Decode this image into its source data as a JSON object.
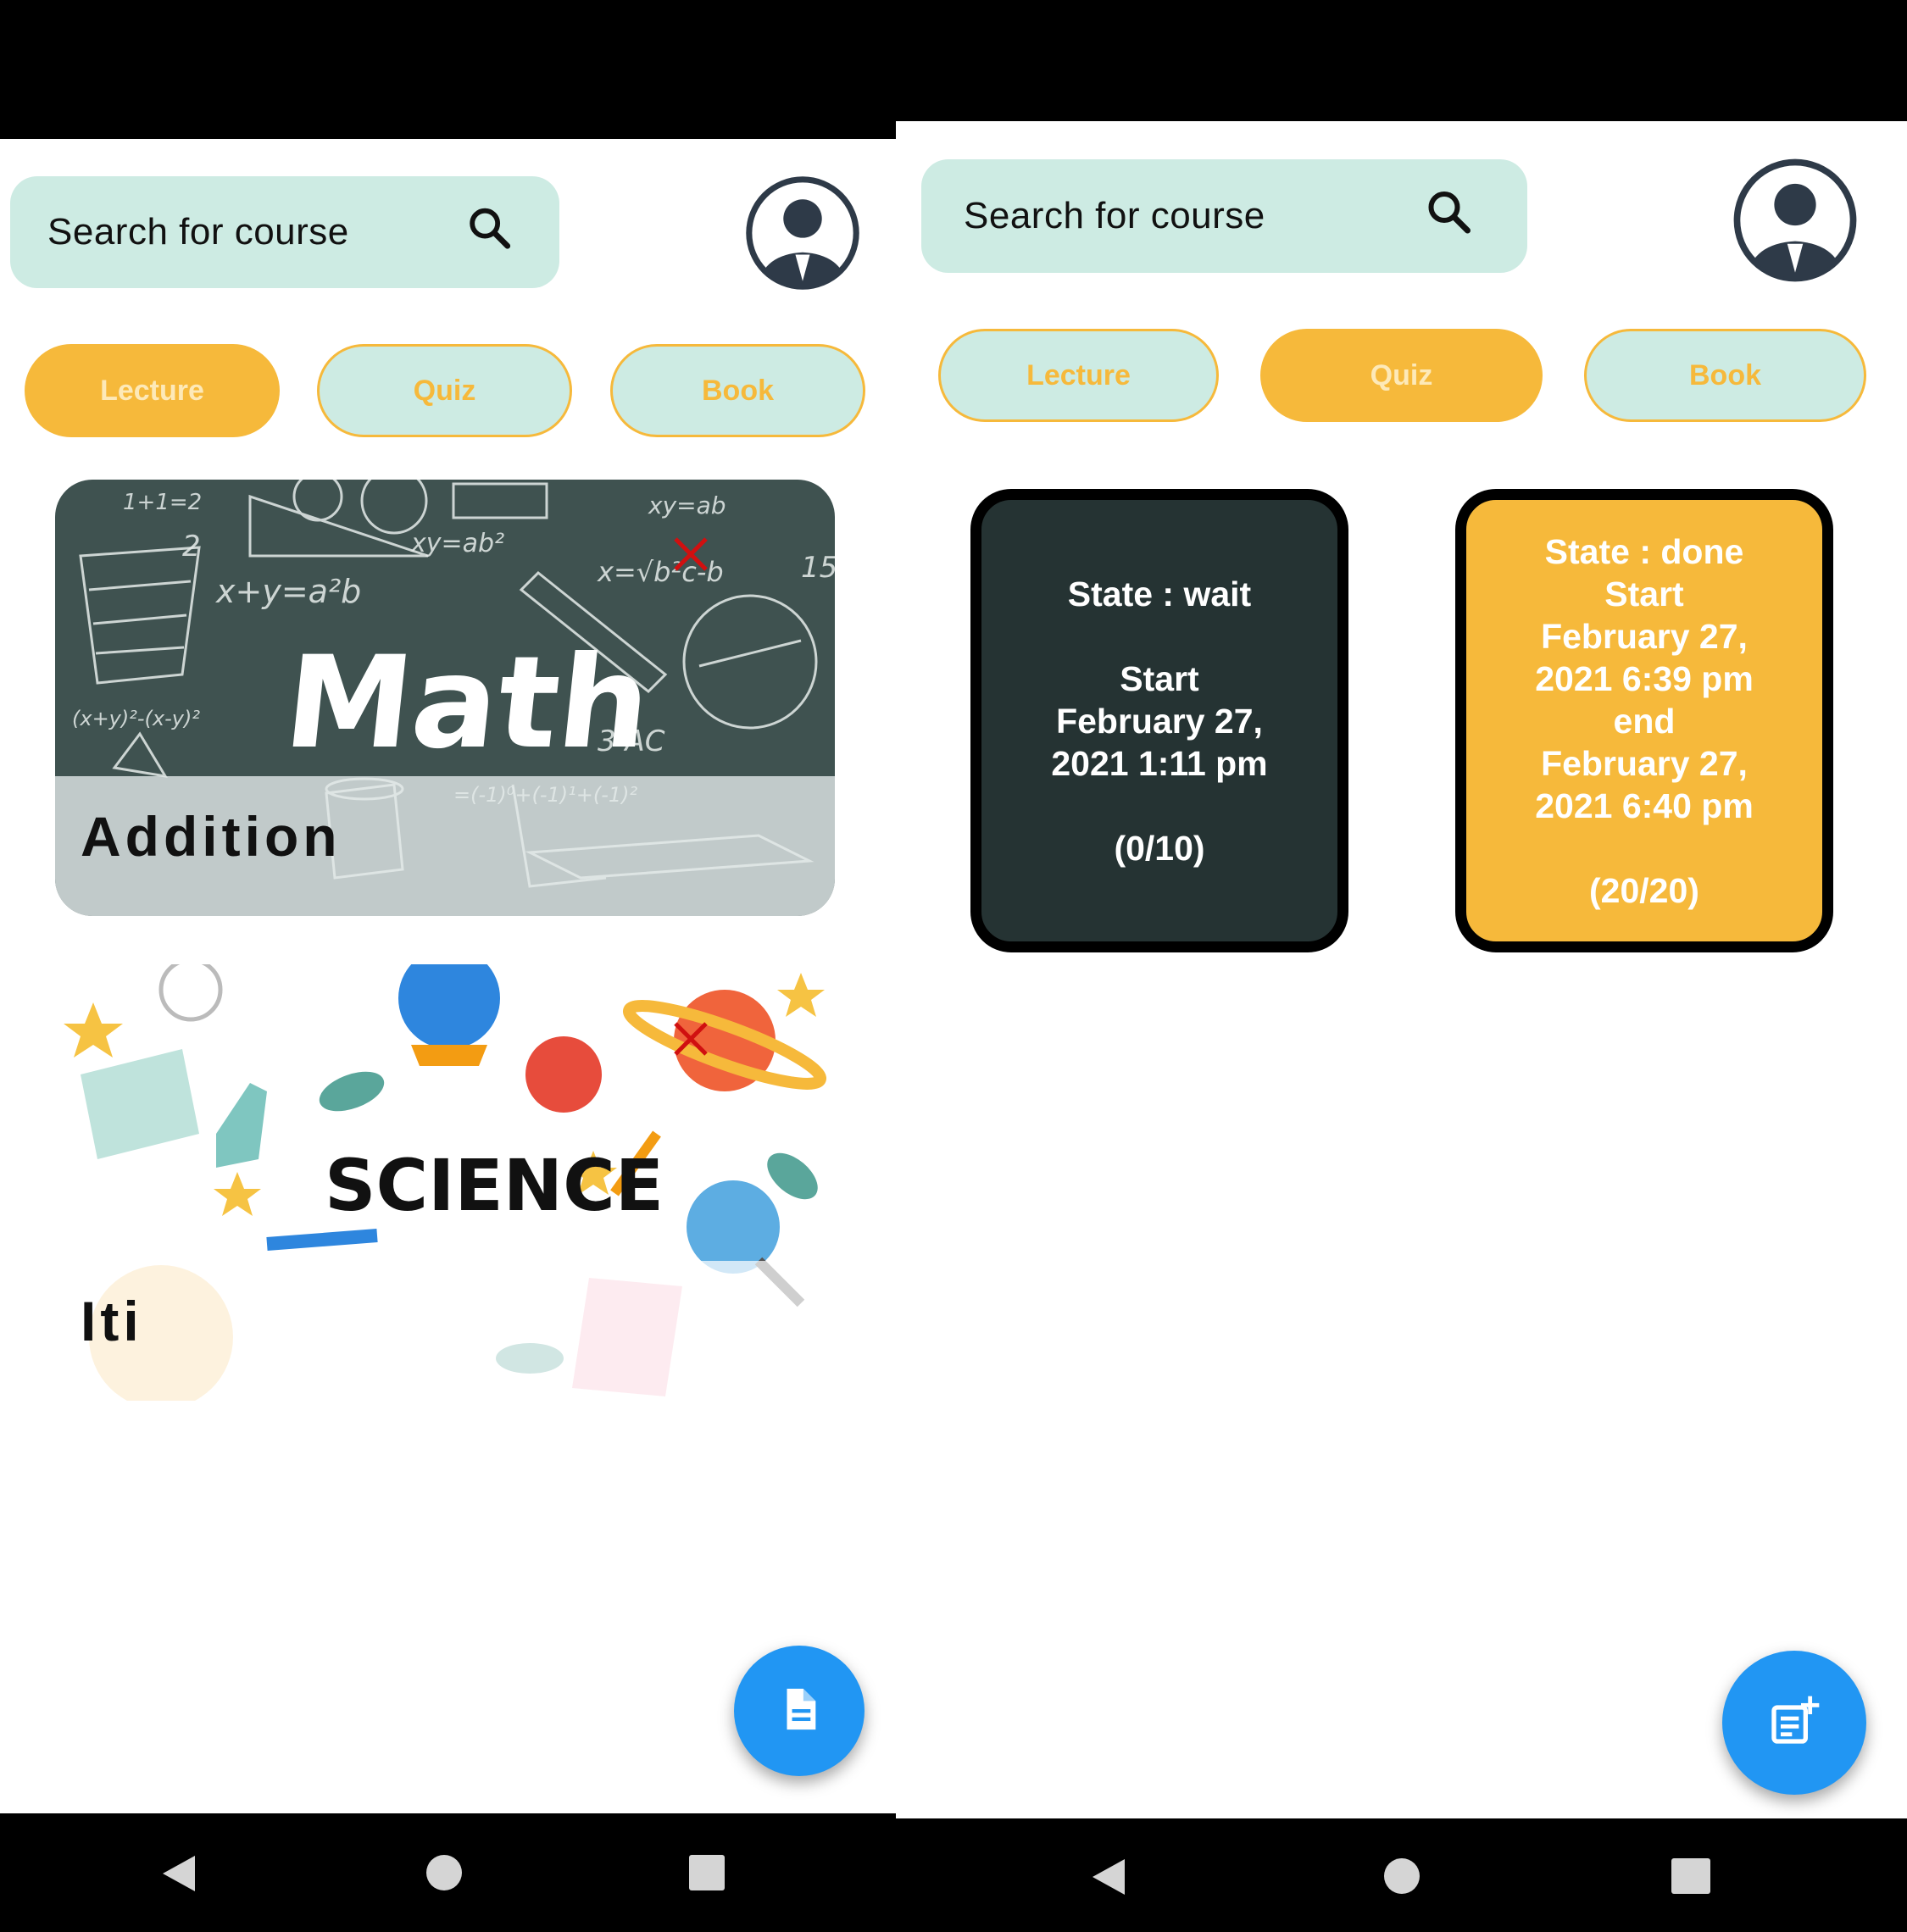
{
  "colors": {
    "accent_orange": "#f6b93b",
    "mint": "#cdebe3",
    "fab_blue": "#2196f3",
    "dark_card": "#253333",
    "delete_red": "#d01010"
  },
  "screens": [
    {
      "search": {
        "placeholder": "Search for course",
        "icon": "search-icon"
      },
      "profile": {
        "icon": "account-avatar-icon"
      },
      "tabs": [
        {
          "label": "Lecture",
          "active": true
        },
        {
          "label": "Quiz",
          "active": false
        },
        {
          "label": "Book",
          "active": false
        }
      ],
      "courses": [
        {
          "name": "Addition",
          "thumb_text": "Math"
        },
        {
          "name": "Iti",
          "thumb_text": "SCIENCE"
        }
      ],
      "fab": {
        "icon": "document-icon"
      }
    },
    {
      "search": {
        "placeholder": "Search for course",
        "icon": "search-icon"
      },
      "profile": {
        "icon": "account-avatar-icon"
      },
      "tabs": [
        {
          "label": "Lecture",
          "active": false
        },
        {
          "label": "Quiz",
          "active": true
        },
        {
          "label": "Book",
          "active": false
        }
      ],
      "quizzes": [
        {
          "state": "State : wait",
          "start_label": "Start",
          "start_date": "February 27,",
          "start_time": "2021 1:11 pm",
          "score": "(0/10)"
        },
        {
          "state": "State : done",
          "start_label": "Start",
          "start_date": "February 27,",
          "start_time": "2021 6:39 pm",
          "end_label": "end",
          "end_date": "February 27,",
          "end_time": "2021 6:40 pm",
          "score": "(20/20)"
        }
      ],
      "fab": {
        "icon": "post-add-icon"
      }
    }
  ],
  "navbar": {
    "back": "back-icon",
    "home": "home-icon",
    "recents": "recents-icon"
  }
}
